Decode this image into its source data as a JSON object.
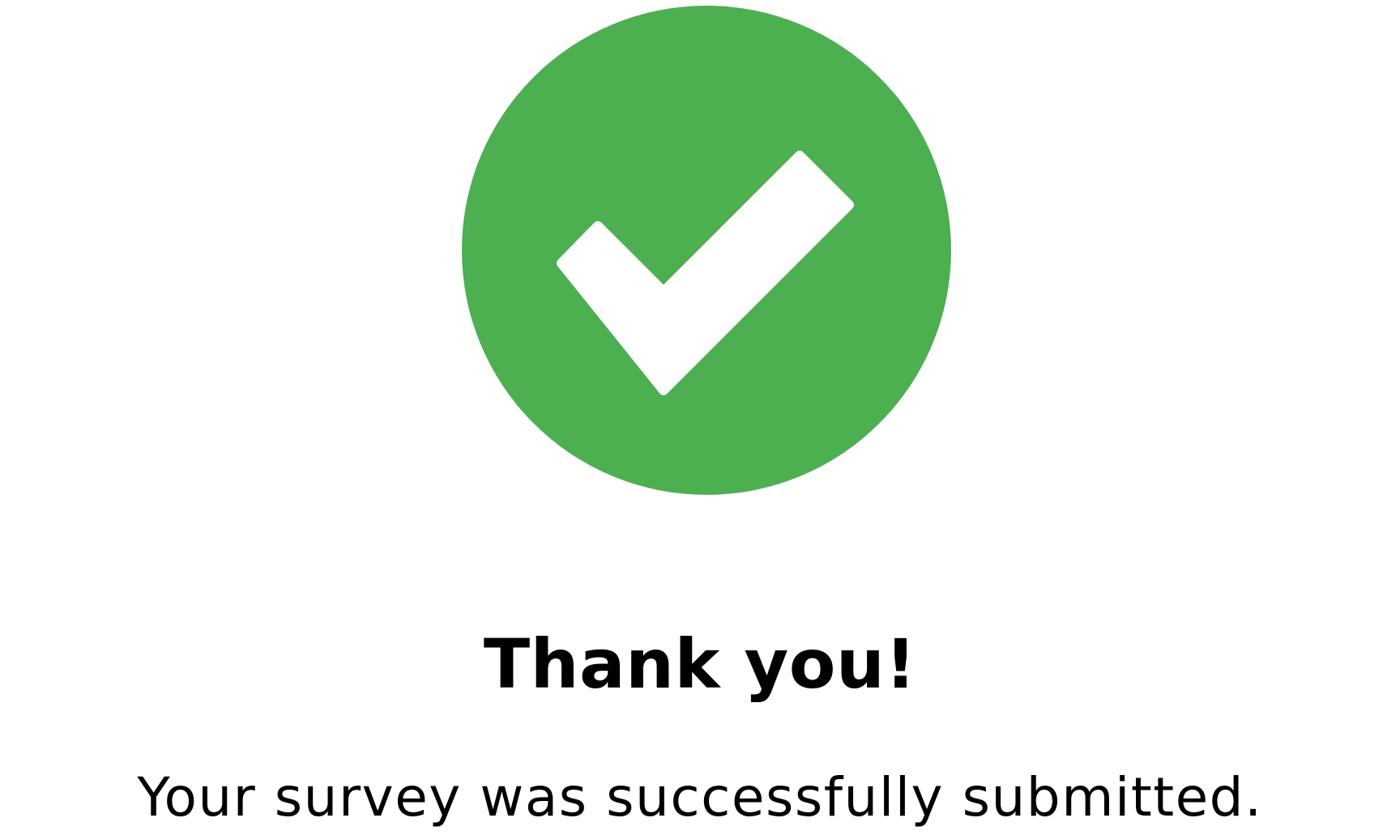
{
  "confirmation": {
    "icon": "check-circle-icon",
    "accent_color": "#4caf50",
    "check_color": "#ffffff",
    "title": "Thank you!",
    "message": "Your survey was successfully submitted."
  }
}
